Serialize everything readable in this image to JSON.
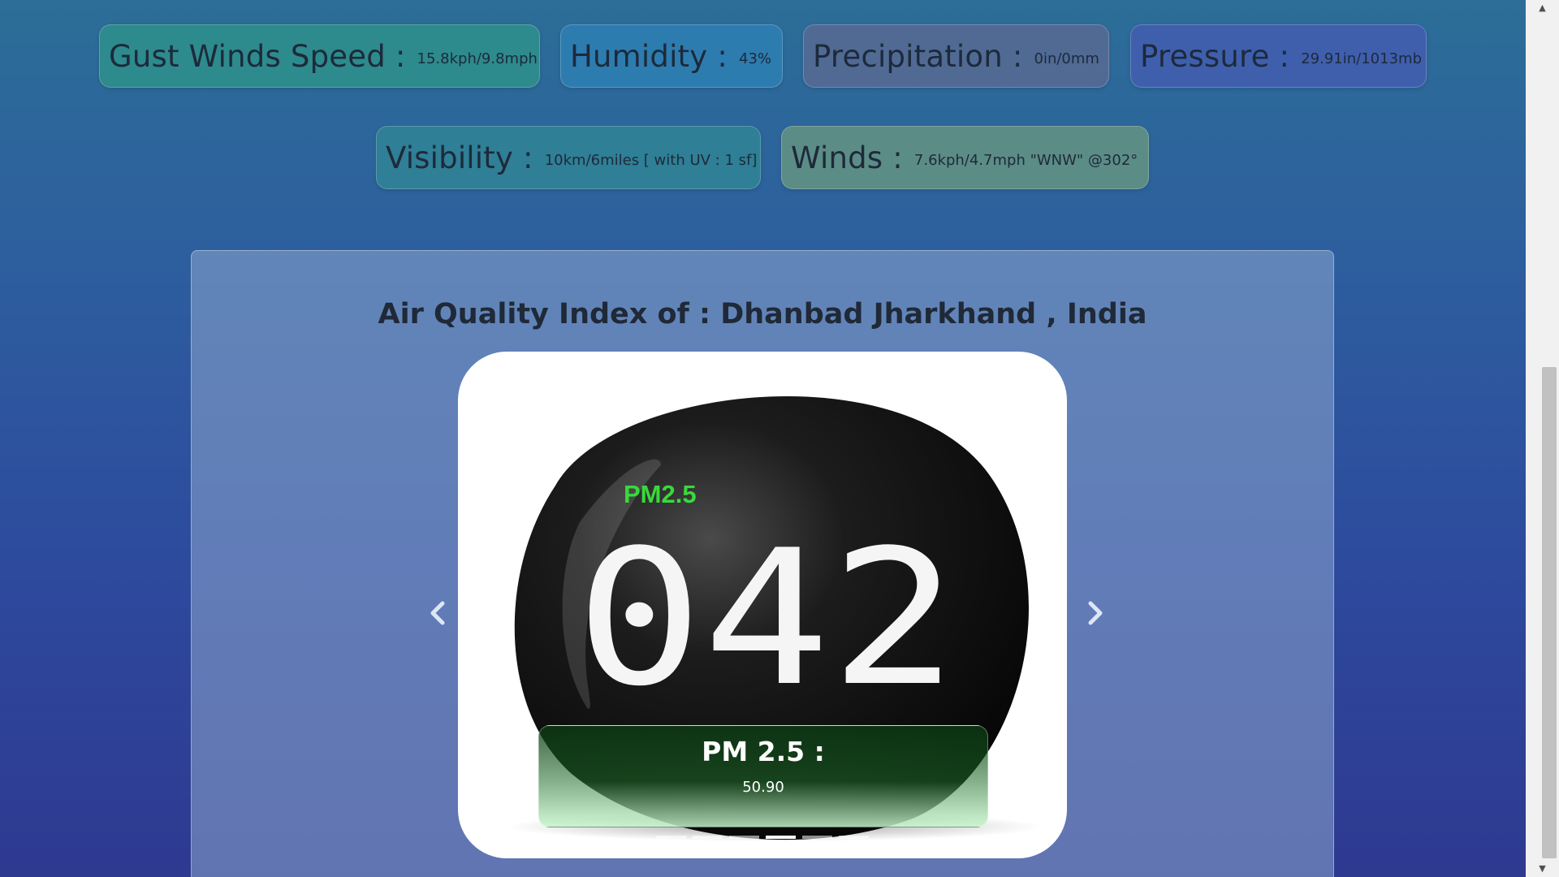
{
  "stats": {
    "gust": {
      "label": "Gust Winds Speed :",
      "value": "15.8kph/9.8mph"
    },
    "humidity": {
      "label": "Humidity :",
      "value": "43%"
    },
    "precipitation": {
      "label": "Precipitation :",
      "value": "0in/0mm"
    },
    "pressure": {
      "label": "Pressure :",
      "value": "29.91in/1013mb"
    },
    "visibility": {
      "label": "Visibility :",
      "value": "10km/6miles [ with UV : 1 sf]"
    },
    "winds": {
      "label": "Winds :",
      "value": "7.6kph/4.7mph \"WNW\" @302°"
    }
  },
  "aqi": {
    "title": "Air Quality Index of : Dhanbad Jharkhand , India",
    "slide_image": {
      "display_label": "PM2.5",
      "display_digits": "042"
    },
    "caption_title": "PM 2.5 :",
    "caption_value": "50.90",
    "indicator_count": 6,
    "active_indicator": 4
  },
  "icons": {
    "prev": "chevron-left-icon",
    "next": "chevron-right-icon",
    "scroll_up": "triangle-up-icon",
    "scroll_down": "triangle-down-icon"
  },
  "colors": {
    "digit_green": "#39d93b",
    "caption_dark": "#0c3c14"
  }
}
